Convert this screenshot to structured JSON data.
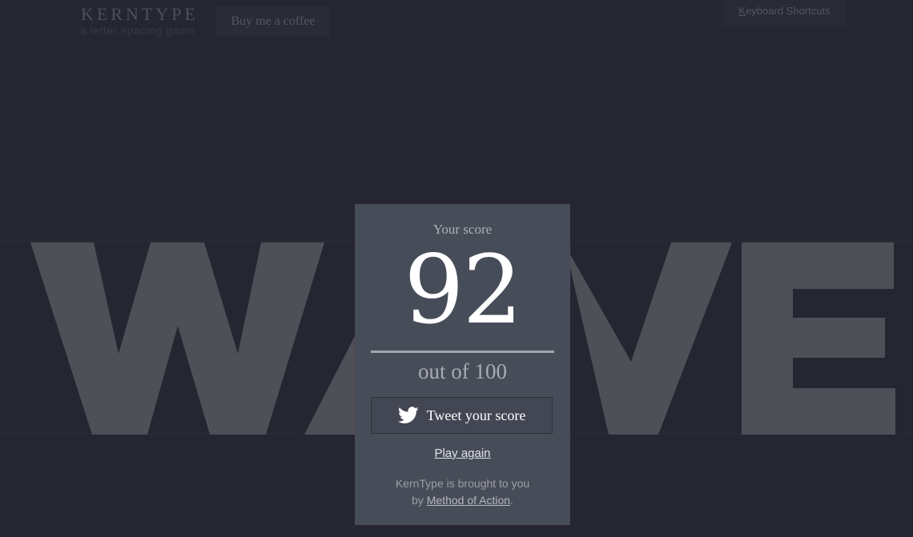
{
  "header": {
    "logo": "KERNTYPE",
    "tagline": "a letter spacing game",
    "coffee_label": "Buy me a coffee",
    "shortcuts_key": "K",
    "shortcuts_rest": "eyboard Shortcuts"
  },
  "game": {
    "word": [
      "W",
      "A",
      "V",
      "E"
    ]
  },
  "score_card": {
    "label": "Your score",
    "score": "92",
    "out_of": "out of 100",
    "tweet_label": "Tweet your score",
    "play_again": "Play again",
    "credit_line1": "KernType is brought to you",
    "credit_by": "by ",
    "credit_link": "Method of Action",
    "credit_end": "."
  },
  "colors": {
    "background": "#262632",
    "letters": "#4f4f57",
    "card": "#474c59"
  }
}
